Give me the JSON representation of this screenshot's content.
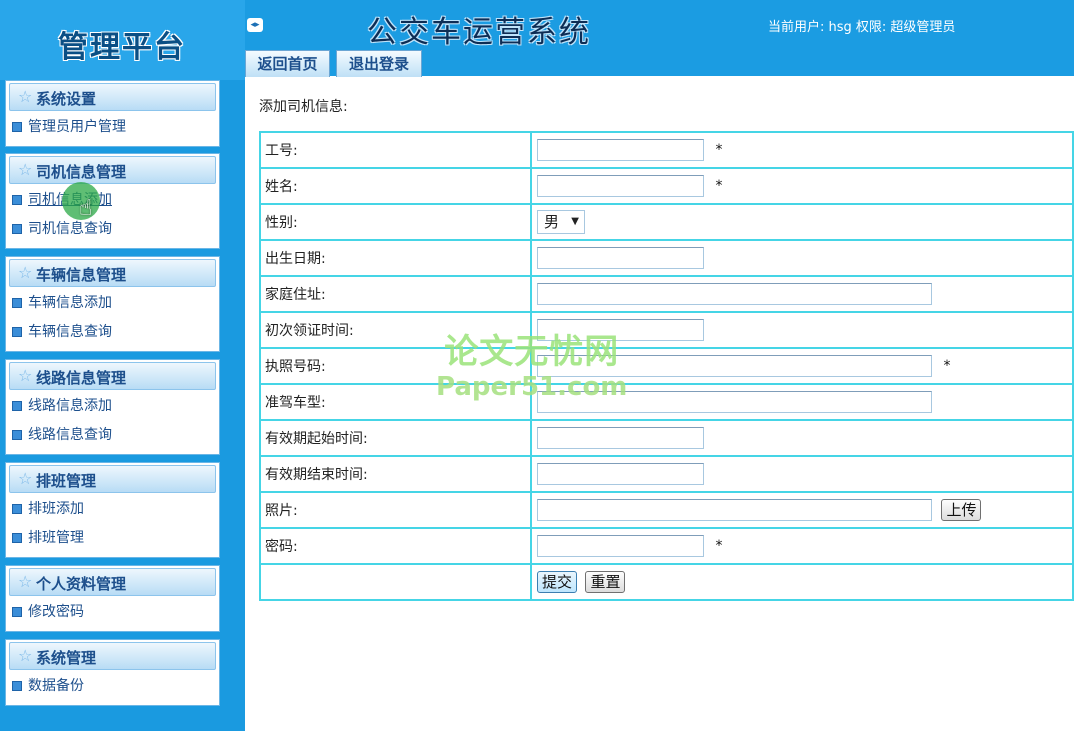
{
  "brand": {
    "title": "管理平台"
  },
  "header": {
    "system_title": "公交车运营系统",
    "user_info": "当前用户: hsg 权限: 超级管理员",
    "tabs": {
      "home": "返回首页",
      "logout": "退出登录"
    }
  },
  "sidebar": {
    "groups": [
      {
        "title": "系统设置",
        "items": [
          "管理员用户管理"
        ]
      },
      {
        "title": "司机信息管理",
        "items": [
          "司机信息添加",
          "司机信息查询"
        ]
      },
      {
        "title": "车辆信息管理",
        "items": [
          "车辆信息添加",
          "车辆信息查询"
        ]
      },
      {
        "title": "线路信息管理",
        "items": [
          "线路信息添加",
          "线路信息查询"
        ]
      },
      {
        "title": "排班管理",
        "items": [
          "排班添加",
          "排班管理"
        ]
      },
      {
        "title": "个人资料管理",
        "items": [
          "修改密码"
        ]
      },
      {
        "title": "系统管理",
        "items": [
          "数据备份"
        ]
      }
    ]
  },
  "form": {
    "heading": "添加司机信息:",
    "required_mark": "*",
    "fields": {
      "employee_id": "工号:",
      "name": "姓名:",
      "gender": "性别:",
      "birth_date": "出生日期:",
      "address": "家庭住址:",
      "first_license_time": "初次领证时间:",
      "license_no": "执照号码:",
      "vehicle_class": "准驾车型:",
      "valid_from": "有效期起始时间:",
      "valid_to": "有效期结束时间:",
      "photo": "照片:",
      "password": "密码:"
    },
    "gender_value": "男",
    "upload_button": "上传",
    "submit_button": "提交",
    "reset_button": "重置"
  },
  "watermark": {
    "cn": "论文无忧网",
    "en": "Paper51.com"
  },
  "colors": {
    "sidebar": "#1a9ae0",
    "header": "#1b9ce2",
    "table_border": "#45d5e6",
    "link": "#1d4f8c"
  }
}
